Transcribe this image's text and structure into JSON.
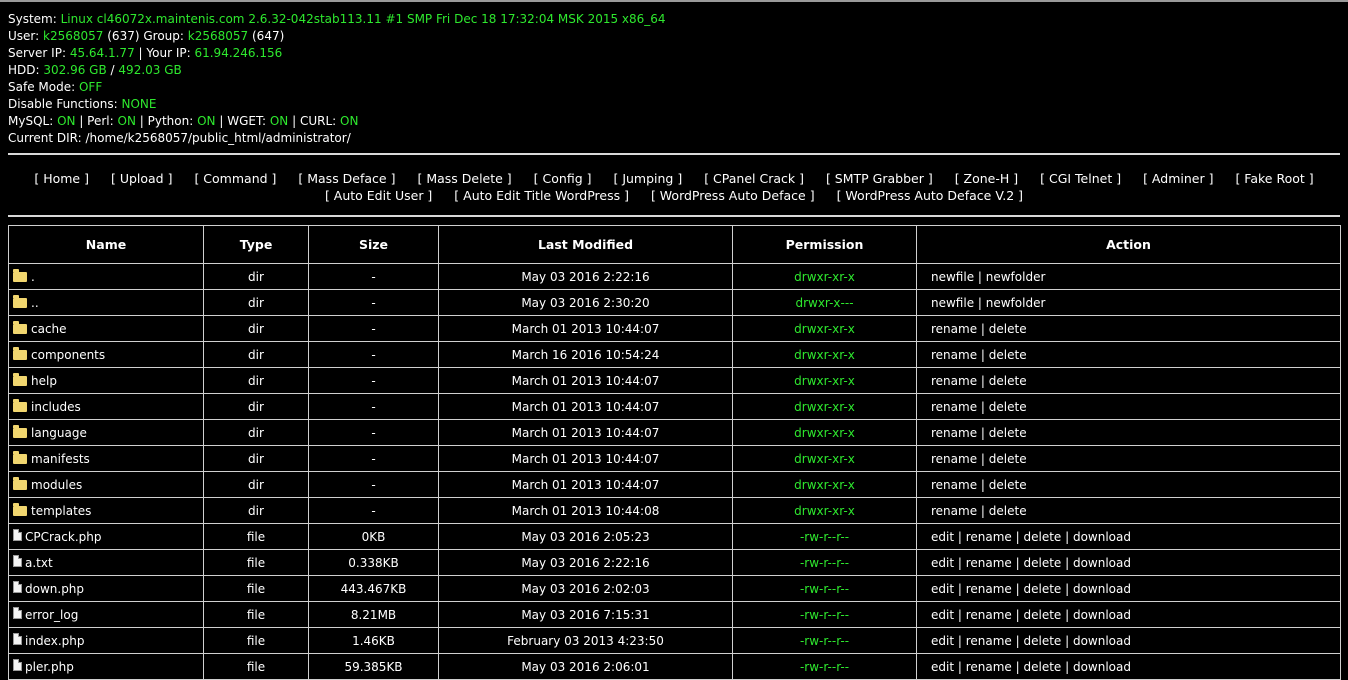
{
  "sysinfo": {
    "system_label": "System:",
    "system_value": "Linux cl46072x.maintenis.com 2.6.32-042stab113.11 #1 SMP Fri Dec 18 17:32:04 MSK 2015 x86_64",
    "user_label": "User:",
    "user_value": "k2568057",
    "user_id": "(637)",
    "group_label": "Group:",
    "group_value": "k2568057",
    "group_id": "(647)",
    "server_ip_label": "Server IP:",
    "server_ip_value": "45.64.1.77",
    "your_ip_label": "| Your IP:",
    "your_ip_value": "61.94.246.156",
    "hdd_label": "HDD:",
    "hdd_free": "302.96 GB",
    "hdd_sep": "/",
    "hdd_total": "492.03 GB",
    "safe_mode_label": "Safe Mode:",
    "safe_mode_value": "OFF",
    "disable_functions_label": "Disable Functions:",
    "disable_functions_value": "NONE",
    "mysql_label": "MySQL:",
    "mysql_value": "ON",
    "perl_label": "| Perl:",
    "perl_value": "ON",
    "python_label": "| Python:",
    "python_value": "ON",
    "wget_label": "| WGET:",
    "wget_value": "ON",
    "curl_label": "| CURL:",
    "curl_value": "ON",
    "current_dir_label": "Current DIR:",
    "current_dir_value": "/home/k2568057/public_html/administrator/"
  },
  "menu": [
    "[ Home ]",
    "[ Upload ]",
    "[ Command ]",
    "[ Mass Deface ]",
    "[ Mass Delete ]",
    "[ Config ]",
    "[ Jumping ]",
    "[ CPanel Crack ]",
    "[ SMTP Grabber ]",
    "[ Zone-H ]",
    "[ CGI Telnet ]",
    "[ Adminer ]",
    "[ Fake Root ]",
    "[ Auto Edit User ]",
    "[ Auto Edit Title WordPress ]",
    "[ WordPress Auto Deface ]",
    "[ WordPress Auto Deface V.2 ]"
  ],
  "table": {
    "headers": [
      "Name",
      "Type",
      "Size",
      "Last Modified",
      "Permission",
      "Action"
    ],
    "rows": [
      {
        "icon": "folder-icon",
        "name": ".",
        "type": "dir",
        "size": "-",
        "modified": "May 03 2016 2:22:16",
        "perm": "drwxr-xr-x",
        "actions": [
          "newfile",
          "newfolder"
        ]
      },
      {
        "icon": "folder-icon",
        "name": "..",
        "type": "dir",
        "size": "-",
        "modified": "May 03 2016 2:30:20",
        "perm": "drwxr-x---",
        "actions": [
          "newfile",
          "newfolder"
        ]
      },
      {
        "icon": "folder-icon",
        "name": "cache",
        "type": "dir",
        "size": "-",
        "modified": "March 01 2013 10:44:07",
        "perm": "drwxr-xr-x",
        "actions": [
          "rename",
          "delete"
        ]
      },
      {
        "icon": "folder-icon",
        "name": "components",
        "type": "dir",
        "size": "-",
        "modified": "March 16 2016 10:54:24",
        "perm": "drwxr-xr-x",
        "actions": [
          "rename",
          "delete"
        ]
      },
      {
        "icon": "folder-icon",
        "name": "help",
        "type": "dir",
        "size": "-",
        "modified": "March 01 2013 10:44:07",
        "perm": "drwxr-xr-x",
        "actions": [
          "rename",
          "delete"
        ]
      },
      {
        "icon": "folder-icon",
        "name": "includes",
        "type": "dir",
        "size": "-",
        "modified": "March 01 2013 10:44:07",
        "perm": "drwxr-xr-x",
        "actions": [
          "rename",
          "delete"
        ]
      },
      {
        "icon": "folder-icon",
        "name": "language",
        "type": "dir",
        "size": "-",
        "modified": "March 01 2013 10:44:07",
        "perm": "drwxr-xr-x",
        "actions": [
          "rename",
          "delete"
        ]
      },
      {
        "icon": "folder-icon",
        "name": "manifests",
        "type": "dir",
        "size": "-",
        "modified": "March 01 2013 10:44:07",
        "perm": "drwxr-xr-x",
        "actions": [
          "rename",
          "delete"
        ]
      },
      {
        "icon": "folder-icon",
        "name": "modules",
        "type": "dir",
        "size": "-",
        "modified": "March 01 2013 10:44:07",
        "perm": "drwxr-xr-x",
        "actions": [
          "rename",
          "delete"
        ]
      },
      {
        "icon": "folder-icon",
        "name": "templates",
        "type": "dir",
        "size": "-",
        "modified": "March 01 2013 10:44:08",
        "perm": "drwxr-xr-x",
        "actions": [
          "rename",
          "delete"
        ]
      },
      {
        "icon": "file-icon",
        "name": "CPCrack.php",
        "type": "file",
        "size": "0KB",
        "modified": "May 03 2016 2:05:23",
        "perm": "-rw-r--r--",
        "actions": [
          "edit",
          "rename",
          "delete",
          "download"
        ]
      },
      {
        "icon": "file-icon",
        "name": "a.txt",
        "type": "file",
        "size": "0.338KB",
        "modified": "May 03 2016 2:22:16",
        "perm": "-rw-r--r--",
        "actions": [
          "edit",
          "rename",
          "delete",
          "download"
        ]
      },
      {
        "icon": "file-icon",
        "name": "down.php",
        "type": "file",
        "size": "443.467KB",
        "modified": "May 03 2016 2:02:03",
        "perm": "-rw-r--r--",
        "actions": [
          "edit",
          "rename",
          "delete",
          "download"
        ]
      },
      {
        "icon": "file-icon",
        "name": "error_log",
        "type": "file",
        "size": "8.21MB",
        "modified": "May 03 2016 7:15:31",
        "perm": "-rw-r--r--",
        "actions": [
          "edit",
          "rename",
          "delete",
          "download"
        ]
      },
      {
        "icon": "file-icon",
        "name": "index.php",
        "type": "file",
        "size": "1.46KB",
        "modified": "February 03 2013 4:23:50",
        "perm": "-rw-r--r--",
        "actions": [
          "edit",
          "rename",
          "delete",
          "download"
        ]
      },
      {
        "icon": "file-icon",
        "name": "pler.php",
        "type": "file",
        "size": "59.385KB",
        "modified": "May 03 2016 2:06:01",
        "perm": "-rw-r--r--",
        "actions": [
          "edit",
          "rename",
          "delete",
          "download"
        ]
      }
    ]
  },
  "colors": {
    "background": "#000000",
    "text": "#ffffff",
    "accent_green": "#2ee82e",
    "folder": "#f1d66f"
  }
}
